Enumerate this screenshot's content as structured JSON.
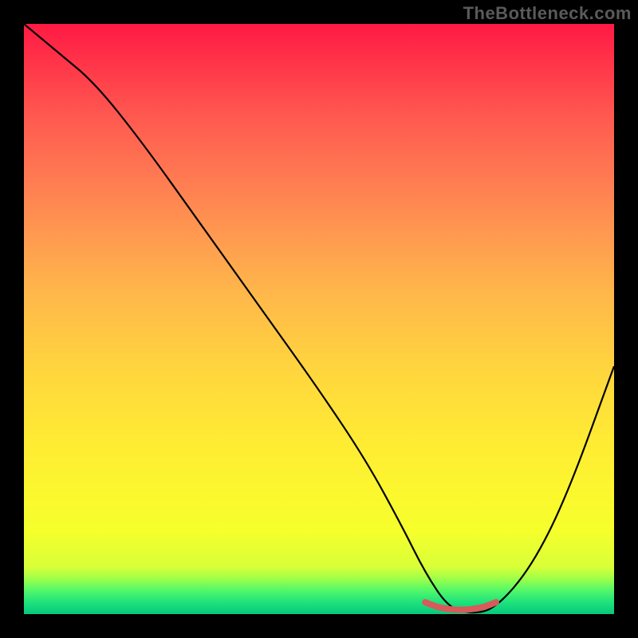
{
  "watermark": "TheBottleneck.com",
  "colors": {
    "frame": "#000000",
    "curve": "#000000",
    "flat_segment": "#d85a5a",
    "gradient_stops": [
      "#ff1a44",
      "#ff3a4a",
      "#ff5a50",
      "#ff7a52",
      "#ff9a50",
      "#ffb84a",
      "#ffd43e",
      "#ffea34",
      "#fbf82e",
      "#f5ff2c",
      "#d9ff38",
      "#9eff49",
      "#52f76a",
      "#1ee27c",
      "#06c97d"
    ]
  },
  "chart_data": {
    "type": "line",
    "title": "",
    "xlabel": "",
    "ylabel": "",
    "xlim": [
      0,
      100
    ],
    "ylim": [
      0,
      100
    ],
    "series": [
      {
        "name": "bottleneck-curve",
        "color": "#000000",
        "x": [
          0,
          6,
          12,
          20,
          30,
          40,
          50,
          58,
          64,
          68,
          72,
          76,
          80,
          86,
          92,
          100
        ],
        "values": [
          100,
          95,
          90,
          80,
          66,
          52,
          38,
          26,
          15,
          7,
          1,
          0,
          1,
          8,
          20,
          42
        ]
      },
      {
        "name": "optimal-flat-segment",
        "color": "#d85a5a",
        "x": [
          68,
          70,
          72,
          74,
          76,
          78,
          80
        ],
        "values": [
          2,
          1.2,
          0.8,
          0.7,
          0.8,
          1.2,
          2
        ]
      }
    ],
    "annotations": []
  }
}
